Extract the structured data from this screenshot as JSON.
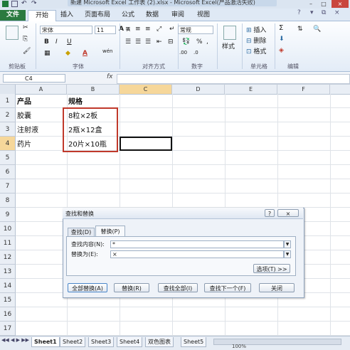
{
  "window": {
    "title": "新建 Microsoft Excel 工作表 (2).xlsx - Microsoft Excel(产品激活失败)"
  },
  "ribbon": {
    "tabs": [
      "文件",
      "开始",
      "插入",
      "页面布局",
      "公式",
      "数据",
      "审阅",
      "视图"
    ],
    "font_name": "宋体",
    "font_size": "11",
    "number_format": "常规",
    "styles_label": "样式",
    "insert_label": "插入",
    "delete_label": "删除",
    "format_label": "格式",
    "groups": {
      "clipboard": "剪贴板",
      "font": "字体",
      "alignment": "对齐方式",
      "number": "数字",
      "cells": "单元格",
      "editing": "编辑"
    },
    "font_grow": "A",
    "font_shrink": "A",
    "bold": "B",
    "italic": "I",
    "underline": "U",
    "font_color": "A",
    "wen": "wén",
    "percent": "%",
    "comma": ",",
    "dec_inc": ".00",
    "dec_dec": ".0"
  },
  "formula_bar": {
    "name_box": "C4",
    "fx": "fx",
    "value": ""
  },
  "sheet": {
    "columns": [
      "A",
      "B",
      "C",
      "D",
      "E",
      "F"
    ],
    "rows": [
      "1",
      "2",
      "3",
      "4",
      "5",
      "6",
      "7",
      "8",
      "9",
      "10",
      "11",
      "12",
      "13",
      "14",
      "15",
      "16",
      "17"
    ],
    "cells": {
      "A1": "产品",
      "B1": "规格",
      "A2": "胶囊",
      "B2": "8粒×2板",
      "A3": "注射液",
      "B3": "2瓶×12盒",
      "A4": "药片",
      "B4": "20片×10瓶"
    },
    "selected_cell": "C4",
    "highlight_color": "#c0392b"
  },
  "dialog": {
    "title": "查找和替换",
    "help": "?",
    "close": "×",
    "tab_find": "查找(D)",
    "tab_replace": "替换(P)",
    "find_label": "查找内容(N):",
    "find_value": "*",
    "replace_label": "替换为(E):",
    "replace_value": "×",
    "options_button": "选项(T) >>",
    "replace_all": "全部替换(A)",
    "replace": "替换(R)",
    "find_all": "查找全部(I)",
    "find_next": "查找下一个(F)",
    "close_button": "关闭"
  },
  "sheet_tabs": [
    "Sheet1",
    "Sheet2",
    "Sheet3",
    "Sheet4",
    "双色图表",
    "Sheet5"
  ],
  "status": {
    "zoom": "100%"
  }
}
